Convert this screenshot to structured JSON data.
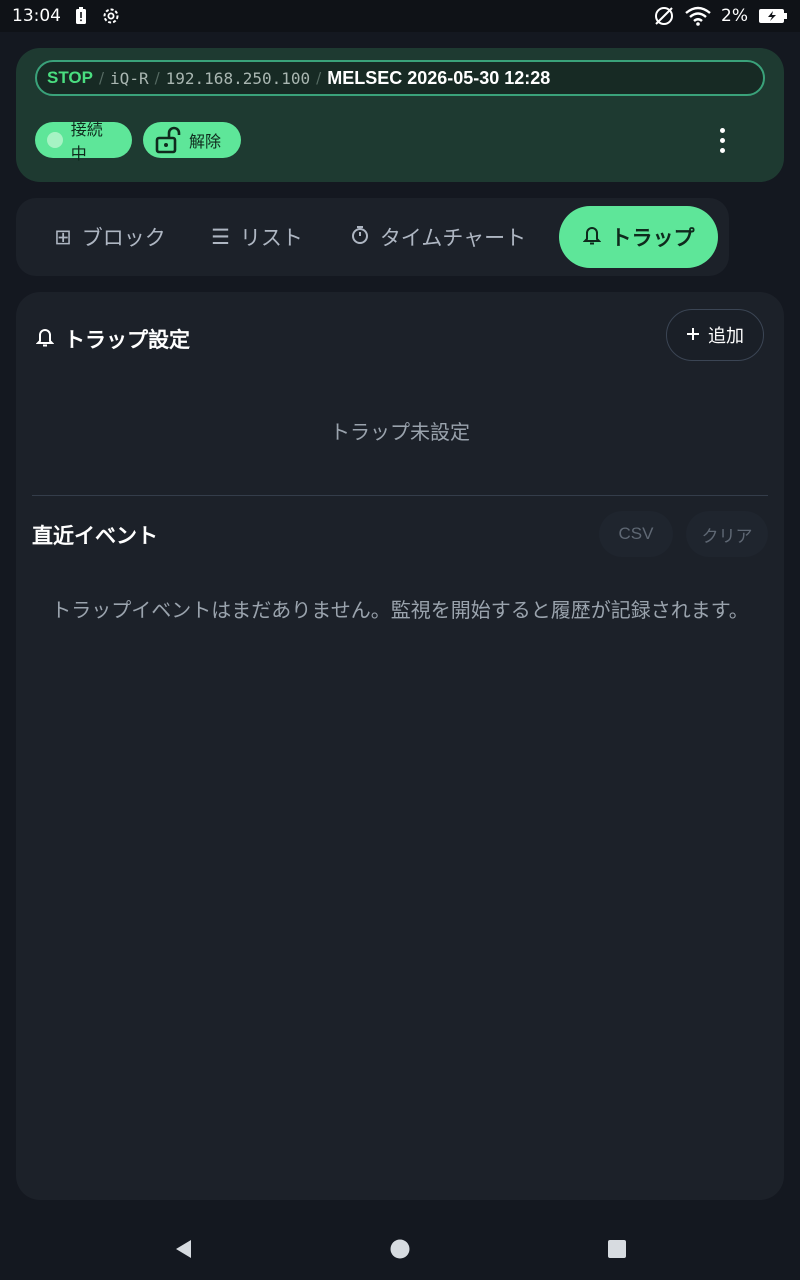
{
  "status_bar": {
    "time": "13:04",
    "battery_percent": "2%",
    "icons": [
      "battery-alert-icon",
      "settings-icon",
      "no-sim-icon",
      "wifi-icon",
      "battery-charging-icon"
    ]
  },
  "header": {
    "path": {
      "state": "STOP",
      "separator": "/",
      "model": "iQ-R",
      "ip": "192.168.250.100",
      "title": "MELSEC 2026-05-30 12:28"
    },
    "connection_chip": "接続中",
    "unlock_chip": "解除"
  },
  "tabs": [
    {
      "icon": "⊞",
      "label": "ブロック",
      "active": false
    },
    {
      "icon": "☰",
      "label": "リスト",
      "active": false
    },
    {
      "icon": "⏱",
      "label": "タイムチャート",
      "active": false
    },
    {
      "icon": "🔔",
      "label": "トラップ",
      "active": true
    }
  ],
  "trap_settings": {
    "title": "トラップ設定",
    "add_label": "追加",
    "empty_message": "トラップ未設定"
  },
  "recent_events": {
    "title": "直近イベント",
    "csv_label": "CSV",
    "clear_label": "クリア",
    "empty_message": "トラップイベントはまだありません。監視を開始すると履歴が記録されます。"
  },
  "colors": {
    "accent": "#5ee699",
    "header_bg": "#1e3a31",
    "page_bg": "#141820",
    "card_bg": "#1c2129",
    "stop_text": "#4ade80"
  }
}
